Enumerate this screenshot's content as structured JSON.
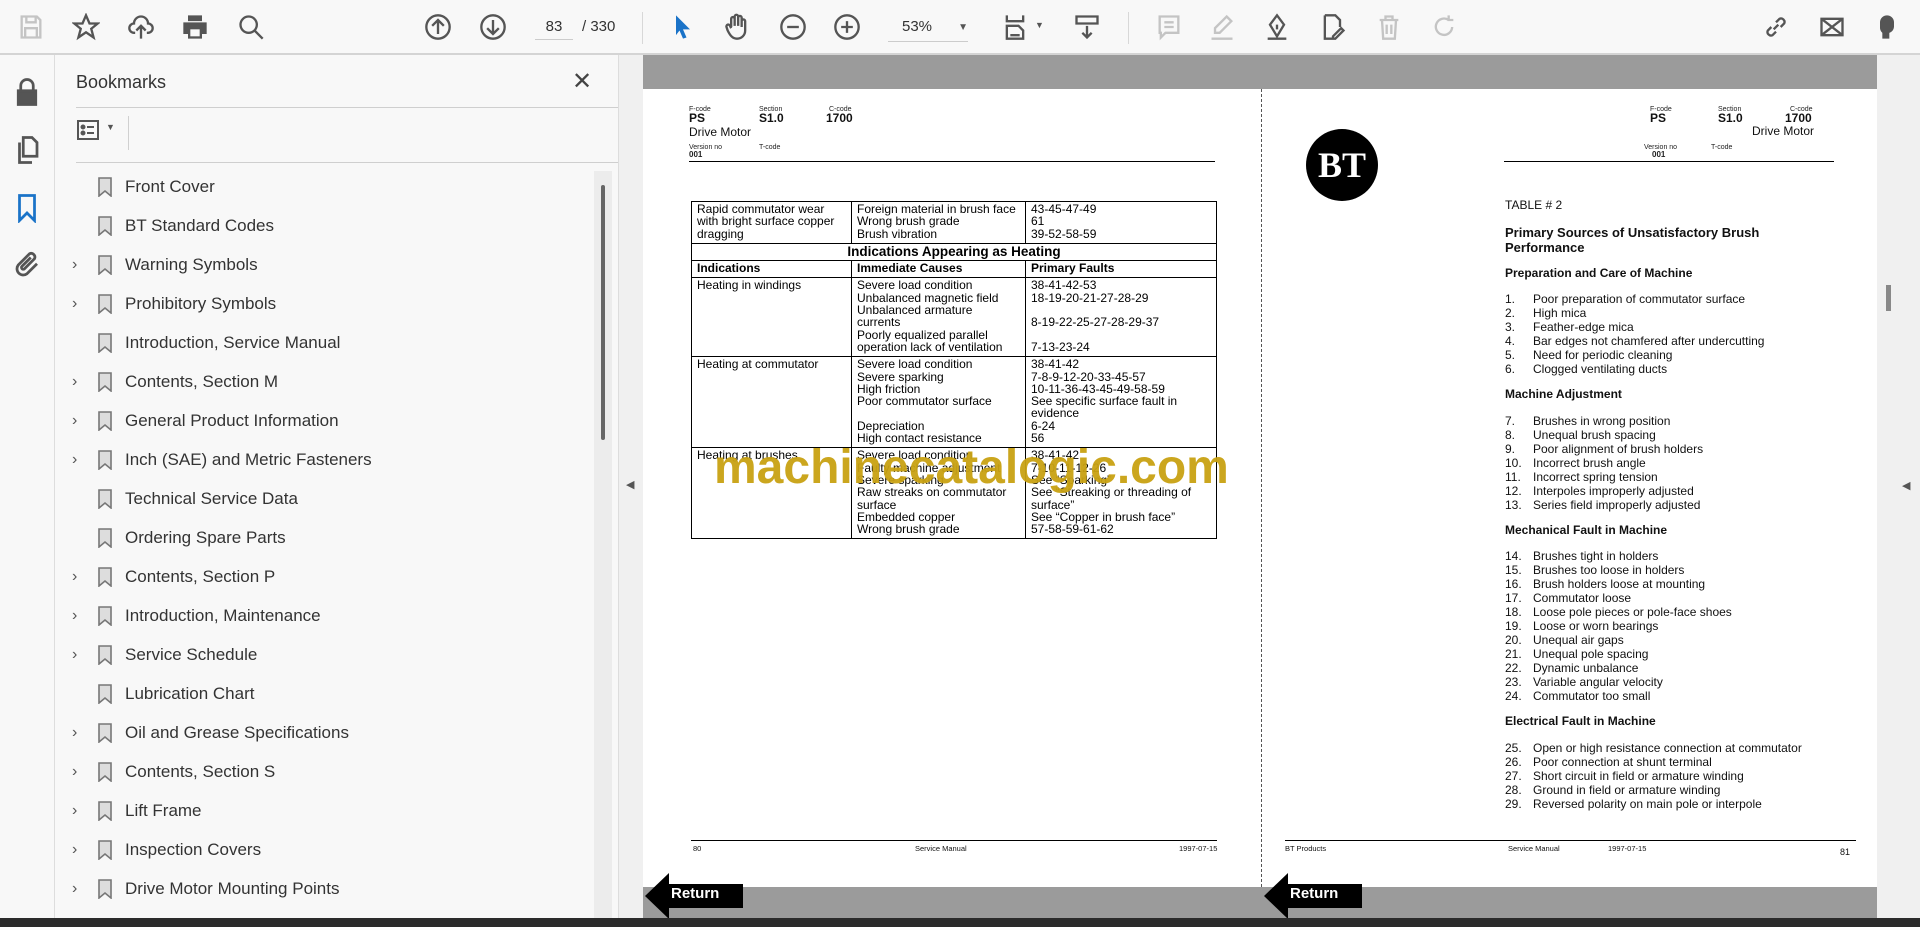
{
  "toolbar": {
    "page_current": "83",
    "page_total": "/ 330",
    "zoom": "53%"
  },
  "panel": {
    "title": "Bookmarks",
    "close": "✕"
  },
  "bookmarks": [
    {
      "label": "Front Cover",
      "expandable": false
    },
    {
      "label": "BT Standard Codes",
      "expandable": false
    },
    {
      "label": "Warning Symbols",
      "expandable": true
    },
    {
      "label": "Prohibitory Symbols",
      "expandable": true
    },
    {
      "label": "Introduction, Service Manual",
      "expandable": false
    },
    {
      "label": "Contents, Section M",
      "expandable": true
    },
    {
      "label": "General Product Information",
      "expandable": true
    },
    {
      "label": "Inch (SAE) and Metric Fasteners",
      "expandable": true
    },
    {
      "label": "Technical Service Data",
      "expandable": false
    },
    {
      "label": "Ordering Spare Parts",
      "expandable": false
    },
    {
      "label": "Contents, Section P",
      "expandable": true
    },
    {
      "label": "Introduction, Maintenance",
      "expandable": true
    },
    {
      "label": "Service Schedule",
      "expandable": true
    },
    {
      "label": "Lubrication Chart",
      "expandable": false
    },
    {
      "label": "Oil and Grease Specifications",
      "expandable": true
    },
    {
      "label": "Contents, Section S",
      "expandable": true
    },
    {
      "label": "Lift Frame",
      "expandable": true
    },
    {
      "label": "Inspection Covers",
      "expandable": true
    },
    {
      "label": "Drive Motor Mounting Points",
      "expandable": true
    }
  ],
  "header": {
    "fcode_label": "F-code",
    "fcode": "PS",
    "section_label": "Section",
    "section": "S1.0",
    "ccode_label": "C-code",
    "ccode": "1700",
    "title": "Drive Motor",
    "version_label": "Version no",
    "version": "001",
    "tcode_label": "T-code"
  },
  "left_page": {
    "row0": {
      "ind": "Rapid commutator wear with bright surface copper dragging",
      "causes": "Foreign material in brush face\nWrong brush grade\nBrush vibration",
      "faults": "43-45-47-49\n61\n39-52-58-59"
    },
    "section_title": "Indications Appearing as Heating",
    "cols": [
      "Indications",
      "Immediate Causes",
      "Primary Faults"
    ],
    "rows": [
      {
        "ind": "Heating in windings",
        "causes": "Severe load condition\nUnbalanced magnetic field\nUnbalanced armature\ncurrents\nPoorly equalized parallel\noperation lack of ventilation",
        "faults": "38-41-42-53\n18-19-20-21-27-28-29\n\n8-19-22-25-27-28-29-37\n\n7-13-23-24"
      },
      {
        "ind": "Heating at commutator",
        "causes": "Severe load condition\nSevere sparking\nHigh friction\nPoor commutator surface\n\nDepreciation\nHigh contact resistance",
        "faults": "38-41-42\n7-8-9-12-20-33-45-57\n10-11-36-43-45-49-58-59\nSee specific surface fault in\nevidence\n6-24\n56"
      },
      {
        "ind": "Heating at brushes",
        "causes": "Severe load condition\nFaulty machine adjustment\nSevere sparking\nRaw streaks on commutator\nsurface\nEmbedded copper\nWrong brush grade",
        "faults": "38-41-42\n7-10-11-12-26\nSee “Sparking”\nSee “Streaking or threading of\nsurface”\nSee “Copper in brush face”\n57-58-59-61-62"
      }
    ],
    "footer": {
      "page": "80",
      "doc": "Service Manual",
      "date": "1997-07-15"
    }
  },
  "right_page": {
    "logo": "BT",
    "table_label": "TABLE # 2",
    "title": "Primary Sources of Unsatisfactory Brush Performance",
    "sections": [
      {
        "title": "Preparation and Care of Machine",
        "items": [
          [
            "1.",
            "Poor preparation of commutator surface"
          ],
          [
            "2.",
            "High mica"
          ],
          [
            "3.",
            "Feather-edge mica"
          ],
          [
            "4.",
            "Bar edges not chamfered after undercutting"
          ],
          [
            "5.",
            "Need for periodic cleaning"
          ],
          [
            "6.",
            "Clogged ventilating ducts"
          ]
        ]
      },
      {
        "title": "Machine Adjustment",
        "items": [
          [
            "7.",
            "Brushes in wrong position"
          ],
          [
            "8.",
            "Unequal brush spacing"
          ],
          [
            "9.",
            "Poor alignment of brush holders"
          ],
          [
            "10.",
            "Incorrect brush angle"
          ],
          [
            "11.",
            "Incorrect spring tension"
          ],
          [
            "12.",
            "Interpoles improperly adjusted"
          ],
          [
            "13.",
            "Series field improperly adjusted"
          ]
        ]
      },
      {
        "title": "Mechanical Fault in Machine",
        "items": [
          [
            "14.",
            "Brushes tight in holders"
          ],
          [
            "15.",
            "Brushes too loose in holders"
          ],
          [
            "16.",
            "Brush holders loose at mounting"
          ],
          [
            "17.",
            "Commutator loose"
          ],
          [
            "18.",
            "Loose pole pieces or pole-face shoes"
          ],
          [
            "19.",
            "Loose or worn bearings"
          ],
          [
            "20.",
            "Unequal air gaps"
          ],
          [
            "21.",
            "Unequal pole spacing"
          ],
          [
            "22.",
            "Dynamic unbalance"
          ],
          [
            "23.",
            "Variable angular velocity"
          ],
          [
            "24.",
            "Commutator too small"
          ]
        ]
      },
      {
        "title": "Electrical Fault in Machine",
        "items": [
          [
            "25.",
            "Open or high resistance connection at commutator"
          ],
          [
            "26.",
            "Poor connection at shunt terminal"
          ],
          [
            "27.",
            "Short circuit in field or armature winding"
          ],
          [
            "28.",
            "Ground in field or armature winding"
          ],
          [
            "29.",
            "Reversed polarity on main pole or interpole"
          ]
        ]
      }
    ],
    "footer": {
      "company": "BT Products",
      "doc": "Service Manual",
      "date": "1997-07-15",
      "page": "81"
    }
  },
  "return_label": "Return",
  "watermark": "machinecatalogic.com",
  "colors": {
    "accent": "#1a73c8",
    "watermark": "#c9a213"
  }
}
